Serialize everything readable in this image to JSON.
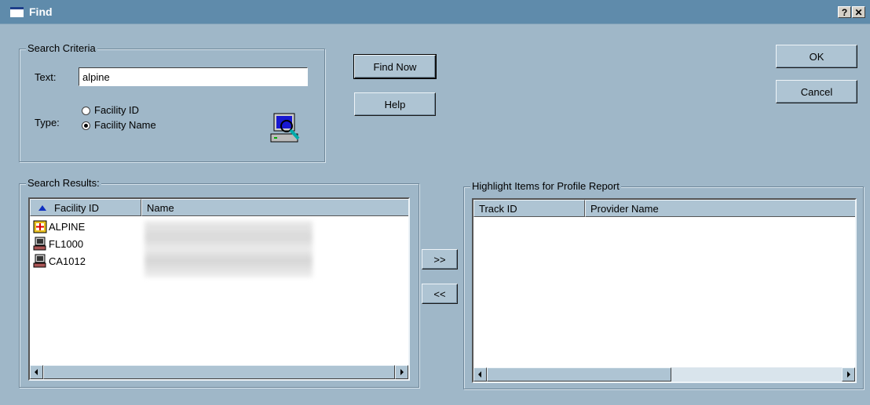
{
  "window": {
    "title": "Find",
    "help_label": "?",
    "close_label": "✕"
  },
  "search_criteria": {
    "legend": "Search Criteria",
    "text_label": "Text:",
    "text_value": "alpine",
    "type_label": "Type:",
    "options": [
      {
        "label": "Facility ID",
        "checked": false
      },
      {
        "label": "Facility Name",
        "checked": true
      }
    ]
  },
  "buttons": {
    "find_now": "Find Now",
    "help": "Help",
    "ok": "OK",
    "cancel": "Cancel",
    "add": ">>",
    "remove": "<<"
  },
  "search_results": {
    "legend": "Search Results:",
    "columns": [
      "Facility ID",
      "Name"
    ],
    "rows": [
      {
        "id": "ALPINE",
        "icon": "facility-hospital-icon"
      },
      {
        "id": "FL1000",
        "icon": "facility-computer-icon"
      },
      {
        "id": "CA1012",
        "icon": "facility-computer-icon"
      }
    ]
  },
  "highlight": {
    "legend": "Highlight Items for Profile Report",
    "columns": [
      "Track ID",
      "Provider Name"
    ]
  }
}
